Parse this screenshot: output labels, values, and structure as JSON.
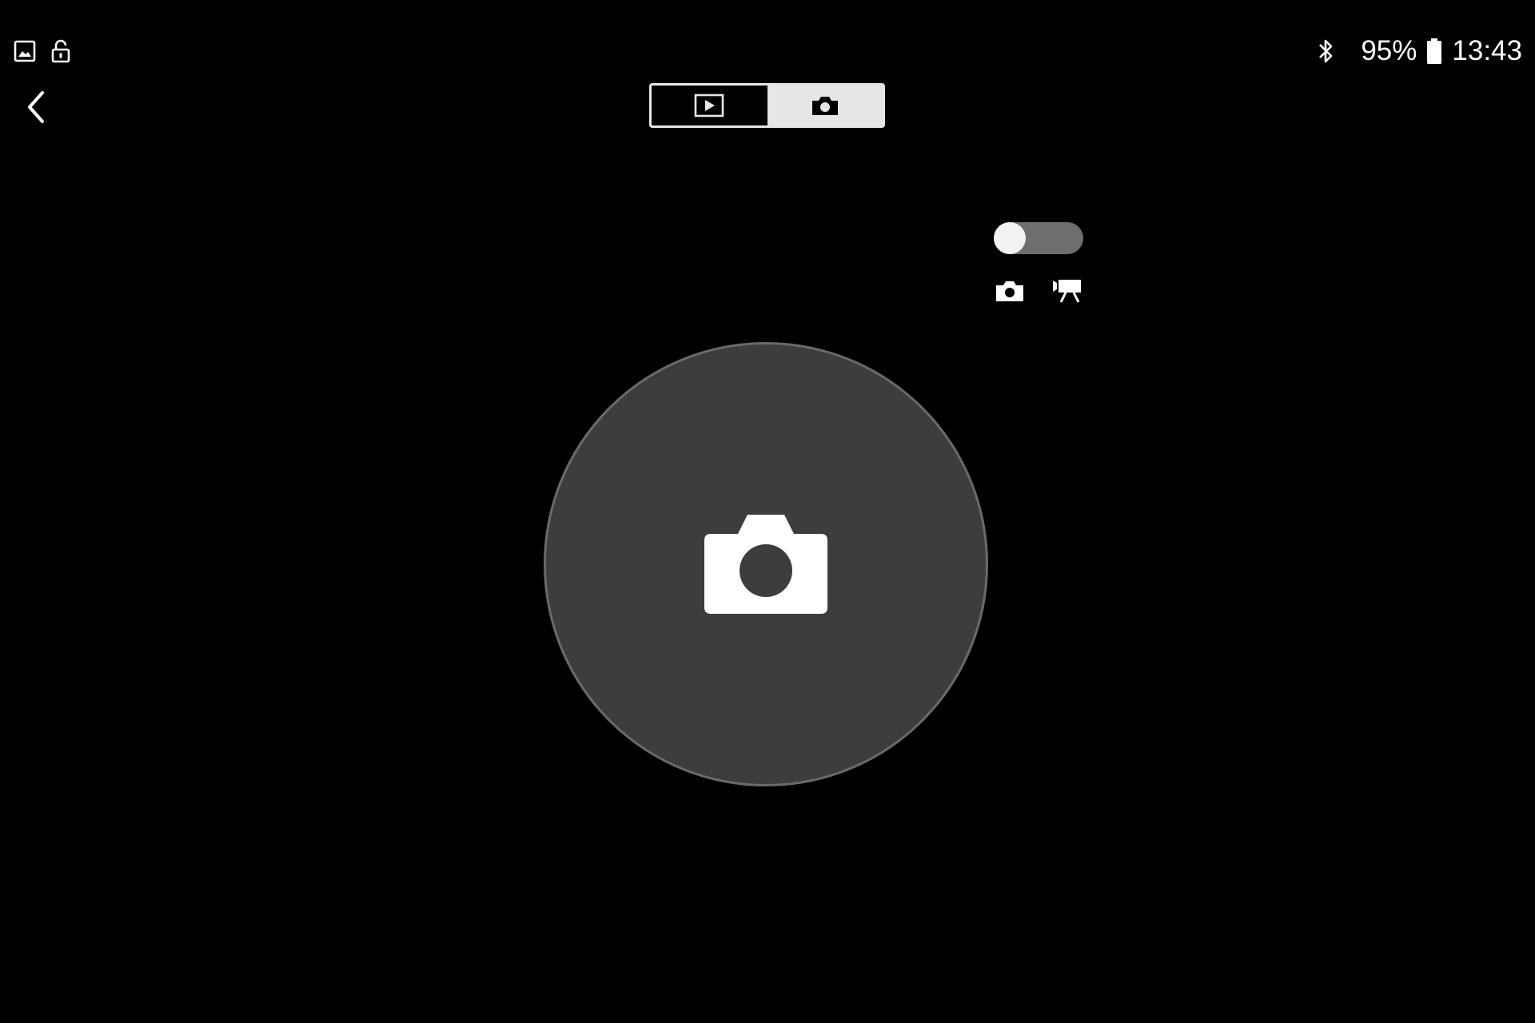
{
  "status_bar": {
    "left_icons": [
      "image-icon",
      "lock-open-icon"
    ],
    "bluetooth_icon": "bluetooth-icon",
    "battery_percent": "95%",
    "battery_icon": "battery-icon",
    "time": "13:43"
  },
  "nav": {
    "back_icon": "chevron-left-icon"
  },
  "mode_switch": {
    "segments": [
      {
        "icon": "playback-icon",
        "selected": false
      },
      {
        "icon": "camera-icon",
        "selected": true
      }
    ]
  },
  "capture_toggle": {
    "state": "photo",
    "left_icon": "camera-icon",
    "right_icon": "video-camera-icon"
  },
  "shutter": {
    "icon": "camera-icon"
  },
  "colors": {
    "background": "#000000",
    "shutter_fill": "#3d3d3d",
    "shutter_border": "#6a6a6a",
    "segment_selected": "#e6e6e6",
    "toggle_track": "#6e6e6e",
    "toggle_knob": "#f2f2f2",
    "foreground": "#ffffff"
  }
}
